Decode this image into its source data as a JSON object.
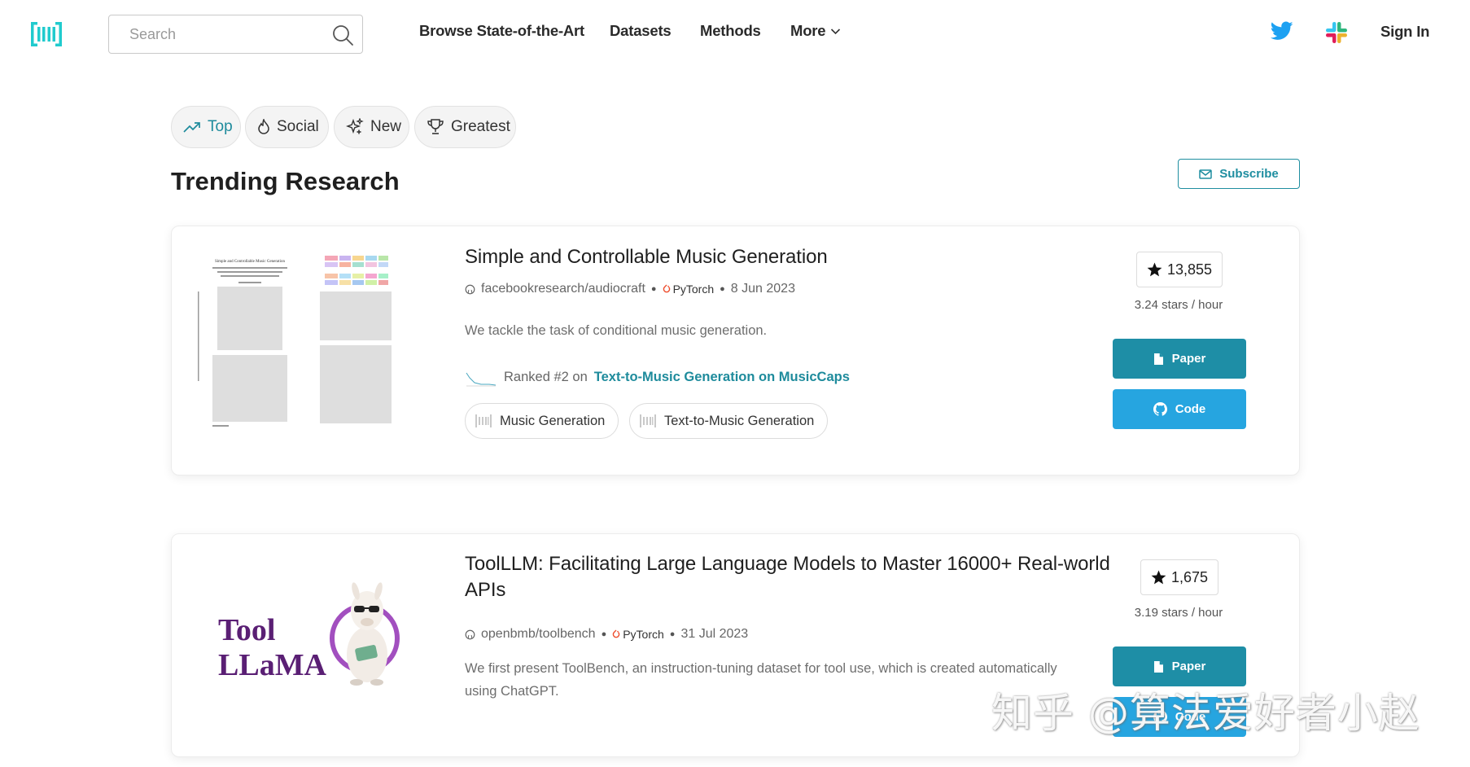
{
  "colors": {
    "accent": "#1e8ea6",
    "code_button": "#26a5e0",
    "twitter": "#1da1f2"
  },
  "nav": {
    "search_placeholder": "Search",
    "links": [
      "Browse State-of-the-Art",
      "Datasets",
      "Methods",
      "More"
    ],
    "sign_in": "Sign In"
  },
  "tabs": [
    {
      "label": "Top",
      "icon": "trending-up-icon",
      "active": true
    },
    {
      "label": "Social",
      "icon": "flame-icon",
      "active": false
    },
    {
      "label": "New",
      "icon": "sparkles-icon",
      "active": false
    },
    {
      "label": "Greatest",
      "icon": "trophy-icon",
      "active": false
    }
  ],
  "page": {
    "title": "Trending Research",
    "subscribe_label": "Subscribe"
  },
  "papers": [
    {
      "title": "Simple and Controllable Music Generation",
      "repo": "facebookresearch/audiocraft",
      "framework": "PyTorch",
      "date": "8 Jun 2023",
      "abstract": "We tackle the task of conditional music generation.",
      "rank_prefix": "Ranked #2 on",
      "rank_task": "Text-to-Music Generation on MusicCaps",
      "tasks": [
        "Music Generation",
        "Text-to-Music Generation"
      ],
      "stars": "13,855",
      "stars_rate": "3.24 stars / hour",
      "paper_label": "Paper",
      "code_label": "Code",
      "thumb_heading": "Simple and Controllable Music Generation"
    },
    {
      "title": "ToolLLM: Facilitating Large Language Models to Master 16000+ Real-world APIs",
      "repo": "openbmb/toolbench",
      "framework": "PyTorch",
      "date": "31 Jul 2023",
      "abstract": "We first present ToolBench, an instruction-tuning dataset for tool use, which is created automatically using ChatGPT.",
      "stars": "1,675",
      "stars_rate": "3.19 stars / hour",
      "paper_label": "Paper",
      "code_label": "Code",
      "thumb_line1": "Tool",
      "thumb_line2": "LLaMA"
    }
  ],
  "watermark": "知乎 @算法爱好者小赵"
}
